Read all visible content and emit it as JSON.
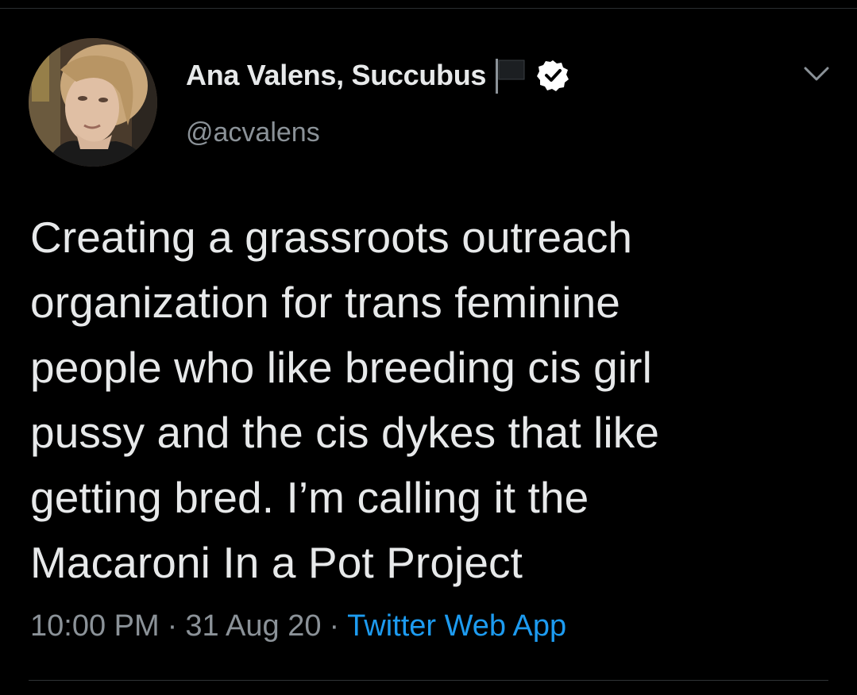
{
  "author": {
    "display_name": "Ana Valens, Succubus",
    "handle": "@acvalens",
    "verified": true,
    "flag_emoji": "black-flag-icon",
    "avatar": "profile-photo"
  },
  "tweet": {
    "lines": [
      "Creating a grassroots outreach",
      "organization for trans feminine",
      "people who like breeding cis girl",
      "pussy and the cis dykes that like",
      "getting bred. I’m calling it the",
      "Macaroni In a Pot Project"
    ]
  },
  "meta": {
    "time": "10:00 PM",
    "separator": "·",
    "date": "31 Aug 20",
    "source": "Twitter Web App"
  },
  "colors": {
    "background": "#000000",
    "text": "#e7e9ea",
    "muted": "#8b9298",
    "link": "#1d9bf0"
  }
}
